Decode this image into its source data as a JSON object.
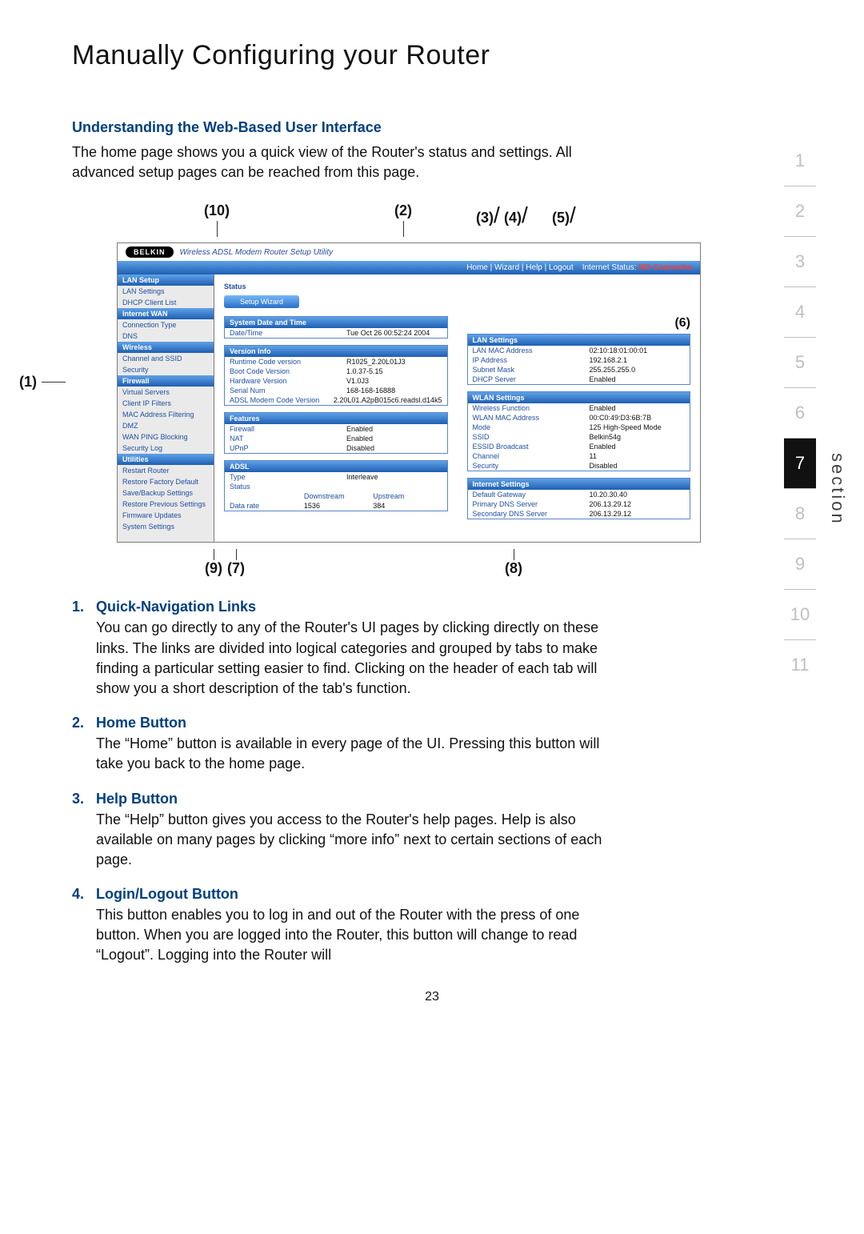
{
  "page_title": "Manually Configuring your Router",
  "subheading": "Understanding the Web-Based User Interface",
  "intro": "The home page shows you a quick view of the Router's status and settings. All advanced setup pages can be reached from this page.",
  "page_number": "23",
  "section_label": "section",
  "section_numbers": [
    "1",
    "2",
    "3",
    "4",
    "5",
    "6",
    "7",
    "8",
    "9",
    "10",
    "11"
  ],
  "section_active": "7",
  "callouts_top": {
    "c10": "(10)",
    "c2": "(2)",
    "c3": "(3)",
    "c4": "(4)",
    "c5": "(5)",
    "c6": "(6)"
  },
  "callouts_side": {
    "c1": "(1)"
  },
  "callouts_bottom": {
    "c9": "(9)",
    "c7": "(7)",
    "c8": "(8)"
  },
  "screenshot": {
    "brand": "BELKIN",
    "app_title": "Wireless ADSL Modem Router Setup Utility",
    "topnav": {
      "links": "Home | Wizard | Help | Logout",
      "status_label": "Internet Status:",
      "status_value": "NO Connectio"
    },
    "sidebar": {
      "groups": [
        {
          "head": "LAN Setup",
          "items": [
            "LAN Settings",
            "DHCP Client List"
          ]
        },
        {
          "head": "Internet WAN",
          "items": [
            "Connection Type",
            "DNS"
          ]
        },
        {
          "head": "Wireless",
          "items": [
            "Channel and SSID",
            "Security"
          ]
        },
        {
          "head": "Firewall",
          "items": [
            "Virtual Servers",
            "Client IP Filters",
            "MAC Address Filtering",
            "DMZ",
            "WAN PING Blocking",
            "Security Log"
          ]
        },
        {
          "head": "Utilities",
          "items": [
            "Restart Router",
            "Restore Factory Default",
            "Save/Backup Settings",
            "Restore Previous Settings",
            "Firmware Updates",
            "System Settings"
          ]
        }
      ]
    },
    "left_col": {
      "status_label": "Status",
      "setup_btn": "Setup Wizard",
      "system": {
        "head": "System Date and Time",
        "rows": [
          [
            "Date/Time",
            "Tue Oct 26 00:52:24 2004"
          ]
        ]
      },
      "version": {
        "head": "Version Info",
        "rows": [
          [
            "Runtime Code version",
            "R1025_2.20L01J3"
          ],
          [
            "Boot Code Version",
            "1.0.37-5.15"
          ],
          [
            "Hardware Version",
            "V1.0J3"
          ],
          [
            "Serial Num",
            "168-168-16888"
          ],
          [
            "ADSL Modem Code Version",
            "2.20L01.A2pB015c6.readsl.d14k5"
          ]
        ]
      },
      "features": {
        "head": "Features",
        "rows": [
          [
            "Firewall",
            "Enabled"
          ],
          [
            "NAT",
            "Enabled"
          ],
          [
            "UPnP",
            "Disabled"
          ]
        ]
      },
      "adsl": {
        "head": "ADSL",
        "rows2": [
          [
            "Type",
            "Interleave",
            ""
          ],
          [
            "Status",
            "",
            ""
          ]
        ],
        "headrow": [
          "",
          "Downstream",
          "Upstream"
        ],
        "rows3": [
          [
            "Data rate",
            "1536",
            "384"
          ]
        ]
      }
    },
    "right_col": {
      "lan": {
        "head": "LAN Settings",
        "rows": [
          [
            "LAN MAC Address",
            "02:10:18:01:00:01"
          ],
          [
            "IP Address",
            "192.168.2.1"
          ],
          [
            "Subnet Mask",
            "255.255.255.0"
          ],
          [
            "DHCP Server",
            "Enabled"
          ]
        ]
      },
      "wlan": {
        "head": "WLAN Settings",
        "rows": [
          [
            "Wireless Function",
            "Enabled"
          ],
          [
            "WLAN MAC Address",
            "00:C0:49:D3:6B:7B"
          ],
          [
            "Mode",
            "125 High-Speed Mode"
          ],
          [
            "SSID",
            "Belkin54g"
          ],
          [
            "ESSID Broadcast",
            "Enabled"
          ],
          [
            "Channel",
            "11"
          ],
          [
            "Security",
            "Disabled"
          ]
        ]
      },
      "internet": {
        "head": "Internet Settings",
        "rows": [
          [
            "Default Gateway",
            "10.20.30.40"
          ],
          [
            "Primary DNS Server",
            "206.13.29.12"
          ],
          [
            "Secondary DNS Server",
            "206.13.29.12"
          ]
        ]
      }
    }
  },
  "items": [
    {
      "num": "1.",
      "title": "Quick-Navigation Links",
      "text": "You can go directly to any of the Router's UI pages by clicking directly on these links. The links are divided into logical categories and grouped by tabs to make finding a particular setting easier to find. Clicking on the header of each tab will show you a short description of the tab's function."
    },
    {
      "num": "2.",
      "title": "Home Button",
      "text": "The “Home” button is available in every page of the UI. Pressing this button will take you back to the home page."
    },
    {
      "num": "3.",
      "title": "Help Button",
      "text": "The “Help” button gives you access to the Router's help pages. Help is also available on many pages by clicking “more info” next to certain sections of each page."
    },
    {
      "num": "4.",
      "title": "Login/Logout Button",
      "text": "This button enables you to log in and out of the Router with the press of one button. When you are logged into the Router, this button will change to read “Logout”. Logging into the Router will"
    }
  ]
}
